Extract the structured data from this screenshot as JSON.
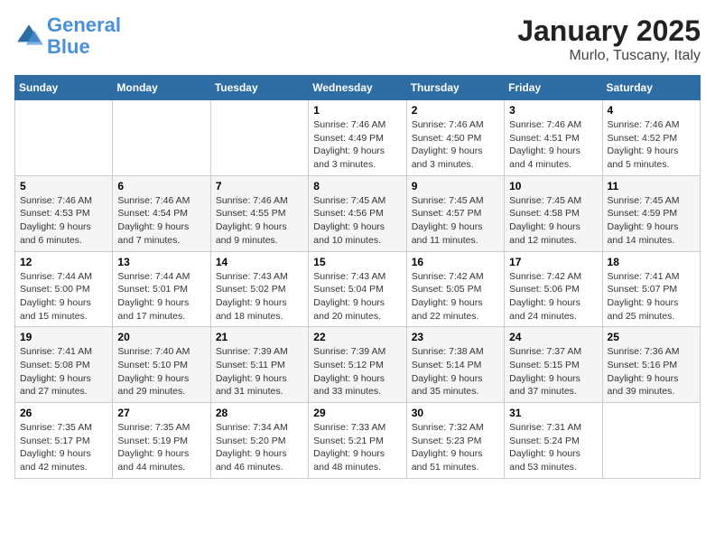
{
  "header": {
    "logo_line1": "General",
    "logo_line2": "Blue",
    "title": "January 2025",
    "subtitle": "Murlo, Tuscany, Italy"
  },
  "weekdays": [
    "Sunday",
    "Monday",
    "Tuesday",
    "Wednesday",
    "Thursday",
    "Friday",
    "Saturday"
  ],
  "weeks": [
    [
      {
        "day": "",
        "info": ""
      },
      {
        "day": "",
        "info": ""
      },
      {
        "day": "",
        "info": ""
      },
      {
        "day": "1",
        "info": "Sunrise: 7:46 AM\nSunset: 4:49 PM\nDaylight: 9 hours and 3 minutes."
      },
      {
        "day": "2",
        "info": "Sunrise: 7:46 AM\nSunset: 4:50 PM\nDaylight: 9 hours and 3 minutes."
      },
      {
        "day": "3",
        "info": "Sunrise: 7:46 AM\nSunset: 4:51 PM\nDaylight: 9 hours and 4 minutes."
      },
      {
        "day": "4",
        "info": "Sunrise: 7:46 AM\nSunset: 4:52 PM\nDaylight: 9 hours and 5 minutes."
      }
    ],
    [
      {
        "day": "5",
        "info": "Sunrise: 7:46 AM\nSunset: 4:53 PM\nDaylight: 9 hours and 6 minutes."
      },
      {
        "day": "6",
        "info": "Sunrise: 7:46 AM\nSunset: 4:54 PM\nDaylight: 9 hours and 7 minutes."
      },
      {
        "day": "7",
        "info": "Sunrise: 7:46 AM\nSunset: 4:55 PM\nDaylight: 9 hours and 9 minutes."
      },
      {
        "day": "8",
        "info": "Sunrise: 7:45 AM\nSunset: 4:56 PM\nDaylight: 9 hours and 10 minutes."
      },
      {
        "day": "9",
        "info": "Sunrise: 7:45 AM\nSunset: 4:57 PM\nDaylight: 9 hours and 11 minutes."
      },
      {
        "day": "10",
        "info": "Sunrise: 7:45 AM\nSunset: 4:58 PM\nDaylight: 9 hours and 12 minutes."
      },
      {
        "day": "11",
        "info": "Sunrise: 7:45 AM\nSunset: 4:59 PM\nDaylight: 9 hours and 14 minutes."
      }
    ],
    [
      {
        "day": "12",
        "info": "Sunrise: 7:44 AM\nSunset: 5:00 PM\nDaylight: 9 hours and 15 minutes."
      },
      {
        "day": "13",
        "info": "Sunrise: 7:44 AM\nSunset: 5:01 PM\nDaylight: 9 hours and 17 minutes."
      },
      {
        "day": "14",
        "info": "Sunrise: 7:43 AM\nSunset: 5:02 PM\nDaylight: 9 hours and 18 minutes."
      },
      {
        "day": "15",
        "info": "Sunrise: 7:43 AM\nSunset: 5:04 PM\nDaylight: 9 hours and 20 minutes."
      },
      {
        "day": "16",
        "info": "Sunrise: 7:42 AM\nSunset: 5:05 PM\nDaylight: 9 hours and 22 minutes."
      },
      {
        "day": "17",
        "info": "Sunrise: 7:42 AM\nSunset: 5:06 PM\nDaylight: 9 hours and 24 minutes."
      },
      {
        "day": "18",
        "info": "Sunrise: 7:41 AM\nSunset: 5:07 PM\nDaylight: 9 hours and 25 minutes."
      }
    ],
    [
      {
        "day": "19",
        "info": "Sunrise: 7:41 AM\nSunset: 5:08 PM\nDaylight: 9 hours and 27 minutes."
      },
      {
        "day": "20",
        "info": "Sunrise: 7:40 AM\nSunset: 5:10 PM\nDaylight: 9 hours and 29 minutes."
      },
      {
        "day": "21",
        "info": "Sunrise: 7:39 AM\nSunset: 5:11 PM\nDaylight: 9 hours and 31 minutes."
      },
      {
        "day": "22",
        "info": "Sunrise: 7:39 AM\nSunset: 5:12 PM\nDaylight: 9 hours and 33 minutes."
      },
      {
        "day": "23",
        "info": "Sunrise: 7:38 AM\nSunset: 5:14 PM\nDaylight: 9 hours and 35 minutes."
      },
      {
        "day": "24",
        "info": "Sunrise: 7:37 AM\nSunset: 5:15 PM\nDaylight: 9 hours and 37 minutes."
      },
      {
        "day": "25",
        "info": "Sunrise: 7:36 AM\nSunset: 5:16 PM\nDaylight: 9 hours and 39 minutes."
      }
    ],
    [
      {
        "day": "26",
        "info": "Sunrise: 7:35 AM\nSunset: 5:17 PM\nDaylight: 9 hours and 42 minutes."
      },
      {
        "day": "27",
        "info": "Sunrise: 7:35 AM\nSunset: 5:19 PM\nDaylight: 9 hours and 44 minutes."
      },
      {
        "day": "28",
        "info": "Sunrise: 7:34 AM\nSunset: 5:20 PM\nDaylight: 9 hours and 46 minutes."
      },
      {
        "day": "29",
        "info": "Sunrise: 7:33 AM\nSunset: 5:21 PM\nDaylight: 9 hours and 48 minutes."
      },
      {
        "day": "30",
        "info": "Sunrise: 7:32 AM\nSunset: 5:23 PM\nDaylight: 9 hours and 51 minutes."
      },
      {
        "day": "31",
        "info": "Sunrise: 7:31 AM\nSunset: 5:24 PM\nDaylight: 9 hours and 53 minutes."
      },
      {
        "day": "",
        "info": ""
      }
    ]
  ]
}
